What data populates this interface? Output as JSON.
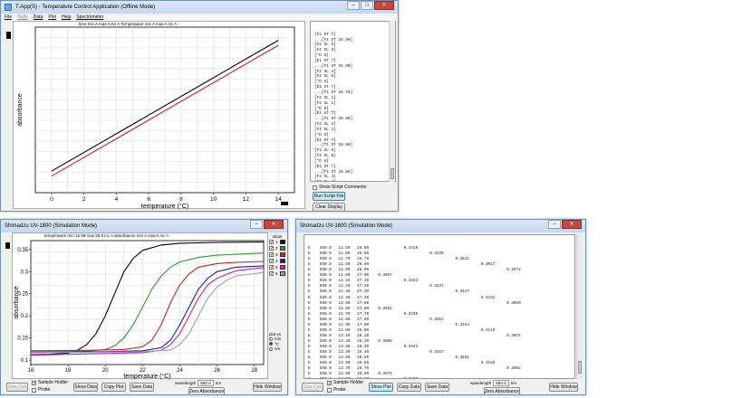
{
  "win1": {
    "title": "T-App(S) - Temperature Control Application (Offline Mode)",
    "menu": [
      "File",
      "Tools",
      "Data",
      "Plot",
      "Help",
      "Spectrometer"
    ],
    "readout": "time min   A    max   A    inc   A        Temperature min   A    max   A    inc   A",
    "script_lines": [
      "[F1 ST 7]",
      "...[F1 ST 28.50]",
      "[F2 SL 5]",
      "[F2 SL 6]",
      "[*D 8]",
      "[E1 ST 7]",
      "...[F1 ST 28.60]",
      "[F2 SL 4]",
      "[F2 SL 6]",
      "[*D 8]",
      "[E1 ST 7]",
      "...[F1 ST 28.70]",
      "[F2 SL 1]",
      "[F2 SL 1]",
      "[*D 8]",
      "[E1 ST 7]",
      "...[F1 ST 28.80]",
      "[F2 SL 2]",
      "[F2 SL 2]",
      "[*D 8]",
      "[E1 ST 7]",
      "...[F1 ST 28.90]",
      "[F2 SL 6]",
      "[F2 SL 0]",
      "[*D 8]",
      "[E1 ST 7]",
      "...[F1 ST 29.00]",
      "[F2 SL 4]",
      "[F2 SL 4]",
      "[*D 8]"
    ],
    "show_comments": "Show Script Comments",
    "run_button": "Run Script File",
    "clear_button": "Clear Display"
  },
  "win2": {
    "title": "Shimadzu UV-1800 (Simulation Mode)",
    "readout": "temperature  min  15.99   max  28.5    inc   A                    absorbance min   A    max   A    inc   A",
    "show_label": "show",
    "legend": [
      {
        "label": "1",
        "color": "#000000"
      },
      {
        "label": "2",
        "color": "#2a9a2a"
      },
      {
        "label": "3",
        "color": "#d02020"
      },
      {
        "label": "4",
        "color": "#1a1aa0"
      },
      {
        "label": "5",
        "color": "#c020c0"
      },
      {
        "label": "6",
        "color": "#a0a0a0"
      }
    ],
    "plot_vs_label": "plot vs",
    "plot_vs_options": [
      "min",
      "°C",
      "nm"
    ],
    "one_cell": "One Cell",
    "sample_holder": "Sample Holder",
    "probe": "Probe",
    "show_data": "Show Data",
    "copy_plot": "Copy Plot",
    "save_data": "Save Data",
    "wavelength_label": "wavelength",
    "wavelength_value": "550.0",
    "wavelength_unit": "nm",
    "zero_absorbance": "Zero Absorbance",
    "hide_window": "Hide Window"
  },
  "win3": {
    "title": "Shimadzu UV-1800 (Simulation Mode)",
    "data_lines": [
      "E    550.0   11.50   26.50               0.3425",
      "E    550.0   11.60   26.60                          0.3239",
      "E    550.0   11.70   26.70                                     0.3121",
      "E    550.0   11.80   26.80                                                0.3047",
      "E    550.0   11.90   26.90                                                           0.2972",
      "E    550.0   12.00   27.00    0.3657",
      "E    550.0   12.10   27.10               0.3431",
      "E    550.0   12.20   27.20                          0.3247",
      "E    550.0   12.30   27.30                                     0.3147",
      "E    550.0   12.40   27.40                                                0.3132",
      "E    550.0   12.50   27.50                                                           0.3050",
      "E    550.0   12.60   27.60    0.3662",
      "E    550.0   12.70   27.70               0.3436",
      "E    550.0   12.80   27.80                          0.3252",
      "E    550.0   12.90   27.90                                     0.3154",
      "E    550.0   13.00   28.00                                                0.3119",
      "E    550.0   13.10   28.10                                                           0.3074",
      "E    550.0   13.20   28.20    0.3665",
      "E    550.0   13.30   28.30               0.3441",
      "E    550.0   13.40   28.40                          0.3257",
      "E    550.0   13.50   28.50                                     0.3161",
      "E    550.0   13.60   28.60                                                0.3126",
      "E    550.0   13.70   28.70                                                           0.3082",
      "E    550.0   13.80   28.80    0.3675",
      "E    550.0   13.90   28.90               0.3447",
      "E    550.0   14.00   29.00                          0.3262"
    ],
    "one_cell": "One Cell",
    "sample_holder": "Sample Holder",
    "probe": "Probe",
    "show_plot": "Show Plot",
    "copy_data": "Copy Data",
    "save_data": "Save Data",
    "wavelength_label": "wavelength",
    "wavelength_value": "550.0",
    "wavelength_unit": "nm",
    "zero_absorbance": "Zero Absorbance",
    "hide_window": "Hide Window"
  },
  "chart_data": [
    {
      "type": "line",
      "title": "",
      "xlabel": "temperature (°C)",
      "ylabel": "absorbance",
      "xlim": [
        -1,
        15
      ],
      "ylim": [
        0,
        1
      ],
      "xticks": [
        0,
        2,
        4,
        6,
        8,
        10,
        12,
        14
      ],
      "yticks": [],
      "grid": true,
      "series": [
        {
          "color": "#000000",
          "x": [
            0,
            14
          ],
          "y": [
            0.13,
            0.92
          ]
        },
        {
          "color": "#d02020",
          "x": [
            0,
            14
          ],
          "y": [
            0.1,
            0.89
          ]
        }
      ]
    },
    {
      "type": "line",
      "title": "",
      "xlabel": "temperature (°C)",
      "ylabel": "absorbance",
      "xlim": [
        16,
        28.5
      ],
      "ylim": [
        0.09,
        0.37
      ],
      "xticks": [
        16,
        18,
        20,
        22,
        24,
        26,
        28
      ],
      "yticks": [
        0.1,
        0.15,
        0.2,
        0.25,
        0.3,
        0.35
      ],
      "grid": true,
      "legend": "right",
      "series": [
        {
          "name": "1",
          "color": "#000000",
          "x": [
            16,
            17,
            18,
            18.5,
            19,
            19.5,
            20,
            20.5,
            21,
            21.5,
            22,
            23,
            24,
            26,
            28.5
          ],
          "y": [
            0.112,
            0.113,
            0.116,
            0.122,
            0.135,
            0.16,
            0.2,
            0.25,
            0.3,
            0.33,
            0.348,
            0.36,
            0.364,
            0.366,
            0.367
          ]
        },
        {
          "name": "2",
          "color": "#2a9a2a",
          "x": [
            16,
            18,
            19,
            20,
            20.5,
            21,
            21.5,
            22,
            22.5,
            23,
            23.5,
            24,
            25,
            26,
            28.5
          ],
          "y": [
            0.118,
            0.119,
            0.12,
            0.124,
            0.132,
            0.15,
            0.18,
            0.22,
            0.26,
            0.29,
            0.31,
            0.322,
            0.332,
            0.337,
            0.342
          ]
        },
        {
          "name": "3",
          "color": "#d02020",
          "x": [
            16,
            19,
            21,
            22,
            22.5,
            23,
            23.5,
            24,
            24.5,
            25,
            26,
            27,
            28.5
          ],
          "y": [
            0.121,
            0.122,
            0.124,
            0.13,
            0.145,
            0.18,
            0.23,
            0.27,
            0.295,
            0.31,
            0.318,
            0.321,
            0.323
          ]
        },
        {
          "name": "4",
          "color": "#1a1aa0",
          "x": [
            16,
            20,
            22,
            23,
            23.5,
            24,
            24.5,
            25,
            25.5,
            26,
            27,
            28.5
          ],
          "y": [
            0.118,
            0.119,
            0.121,
            0.128,
            0.145,
            0.18,
            0.22,
            0.26,
            0.285,
            0.3,
            0.31,
            0.313
          ]
        },
        {
          "name": "5",
          "color": "#c020c0",
          "x": [
            16,
            18,
            20,
            22,
            23,
            23.5,
            24,
            24.5,
            25,
            25.5,
            26,
            27,
            28.5
          ],
          "y": [
            0.111,
            0.113,
            0.115,
            0.117,
            0.122,
            0.135,
            0.16,
            0.2,
            0.24,
            0.27,
            0.285,
            0.302,
            0.309
          ]
        },
        {
          "name": "6",
          "color": "#a0a0a0",
          "x": [
            16,
            20,
            22,
            23.5,
            24,
            24.5,
            25,
            25.5,
            26,
            26.5,
            27,
            28.5
          ],
          "y": [
            0.117,
            0.118,
            0.119,
            0.123,
            0.135,
            0.16,
            0.2,
            0.24,
            0.265,
            0.28,
            0.29,
            0.298
          ]
        }
      ]
    }
  ]
}
